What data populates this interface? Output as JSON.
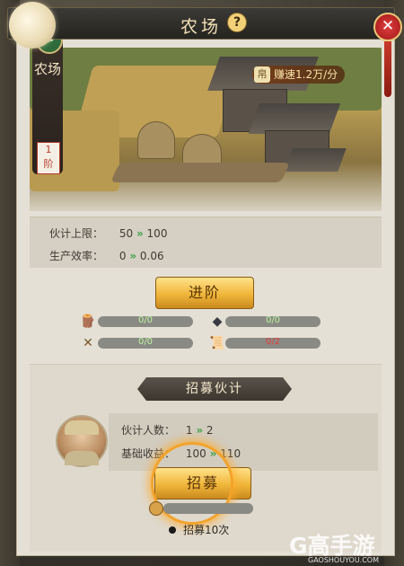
{
  "header": {
    "title": "农场",
    "help_label": "?",
    "close_label": "✕"
  },
  "building": {
    "name": "农场",
    "level_num": "1",
    "level_unit": "阶",
    "earn_rate": "赚速1.2万/分"
  },
  "stats": [
    {
      "label": "伙计上限：",
      "from": "50",
      "to": "100"
    },
    {
      "label": "生产效率：",
      "from": "0",
      "to": "0.06"
    }
  ],
  "upgrade_button": "进阶",
  "resources": [
    {
      "icon": "wood-log-icon",
      "glyph": "🪵",
      "value_text": "0/0",
      "progress": 0.0
    },
    {
      "icon": "coal-icon",
      "glyph": "◆",
      "value_text": "0/0",
      "progress": 0.0
    },
    {
      "icon": "tools-icon",
      "glyph": "✕",
      "value_text": "0/0",
      "progress": 0.0
    },
    {
      "icon": "scroll-icon",
      "glyph": "📜",
      "value_text": "0/2",
      "progress": 0.0
    }
  ],
  "recruit": {
    "banner": "招募伙计",
    "worker_count_label": "伙计人数：",
    "worker_count_from": "1",
    "worker_count_to": "2",
    "base_income_label": "基础收益：",
    "base_income_from": "100",
    "base_income_to": "110",
    "button": "招募",
    "tip": "招募10次"
  },
  "watermark": {
    "brand": "G高手游",
    "url": "GAOSHOUYOU.COM"
  },
  "colors": {
    "gold": "#f0b63a",
    "green_arrow": "#3fa04a",
    "red_close": "#c01c1c"
  }
}
